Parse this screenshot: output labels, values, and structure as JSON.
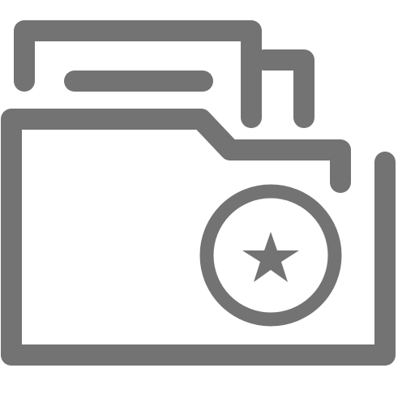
{
  "icon": {
    "name": "starred-folder-icon",
    "stroke_color": "#737373",
    "background_color": "#ffffff"
  }
}
